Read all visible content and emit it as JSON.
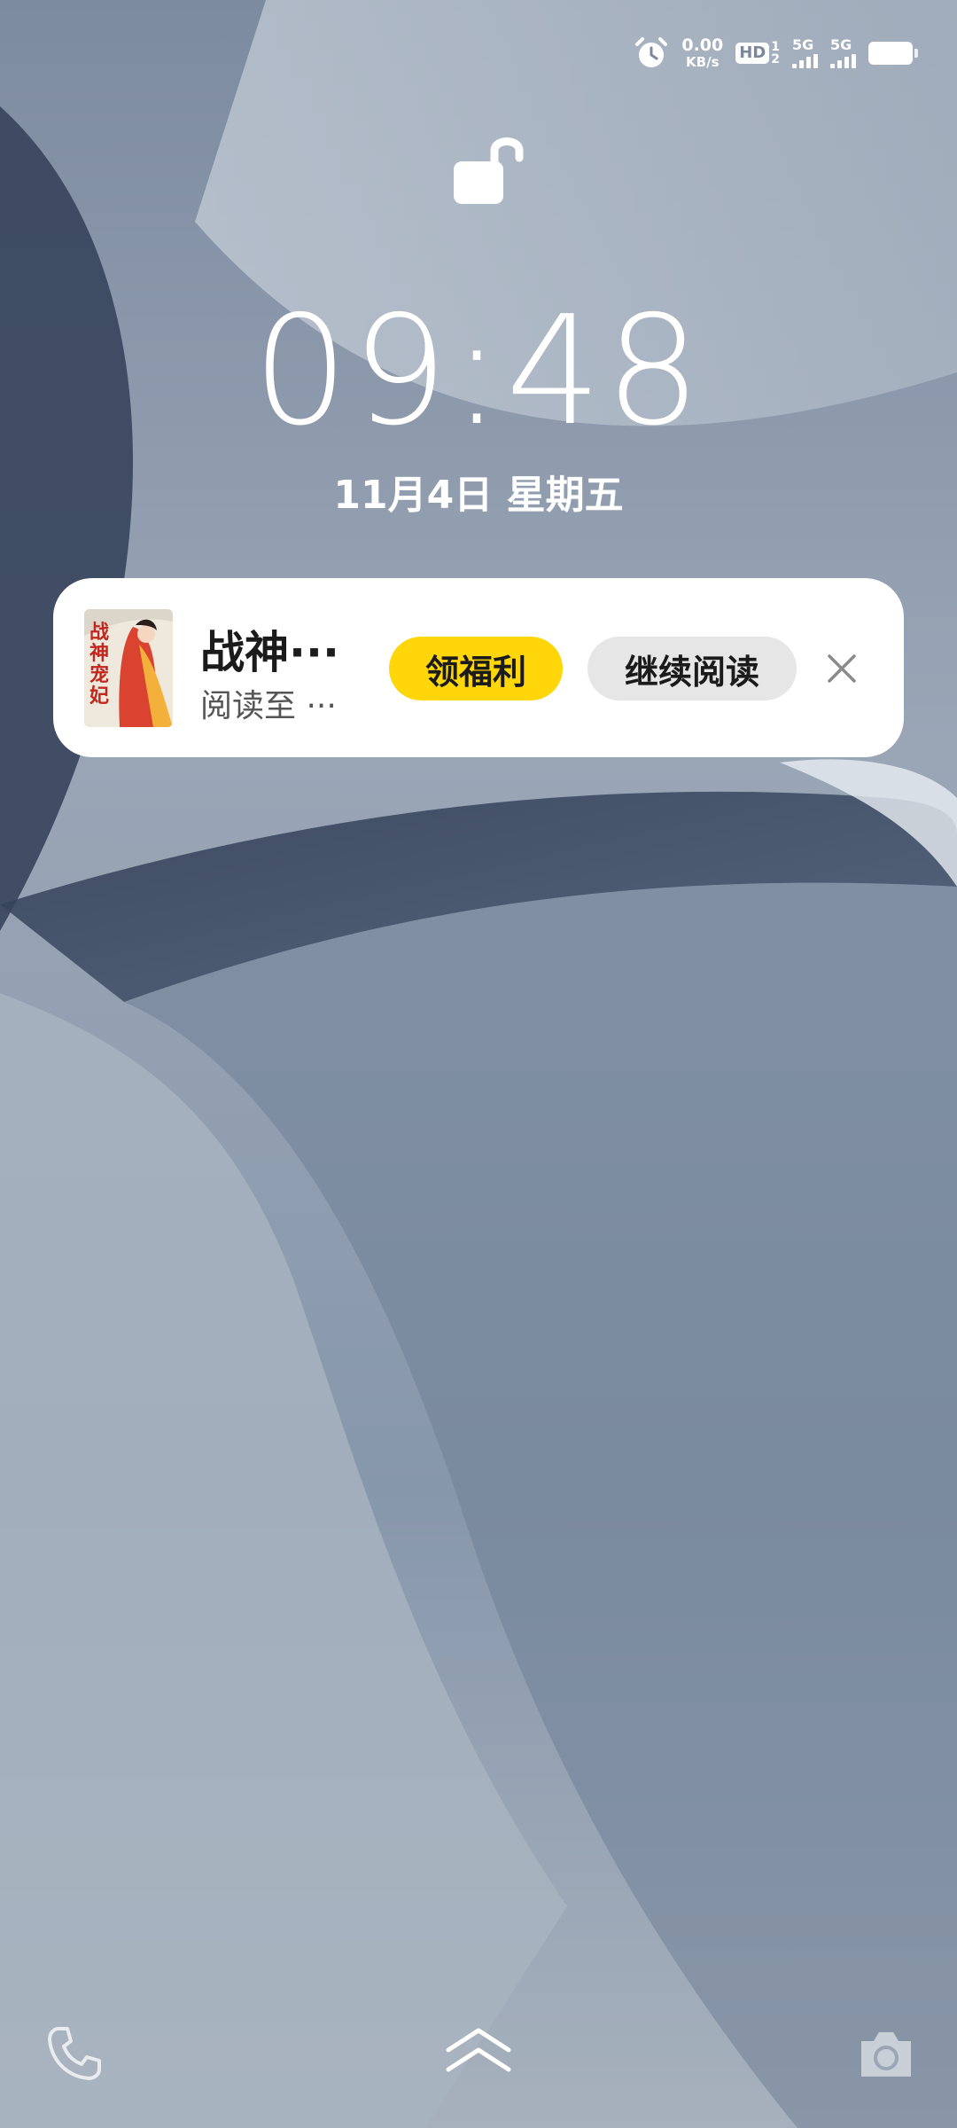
{
  "status_bar": {
    "alarm_icon": "alarm-clock-icon",
    "net_speed_value": "0.00",
    "net_speed_unit": "KB/s",
    "hd_label": "HD",
    "hd_sim_top": "1",
    "hd_sim_bottom": "2",
    "sim1_label": "5G",
    "sim2_label": "5G",
    "battery_icon": "battery-icon"
  },
  "lock_icon": "unlocked-padlock-icon",
  "clock": {
    "time": "09:48",
    "date": "11月4日  星期五"
  },
  "notification": {
    "title": "战神···",
    "subtitle": "阅读至 ···",
    "cover_text": "战神宠妃",
    "welfare_button": "领福利",
    "continue_button": "继续阅读",
    "welfare_color": "#ffd60a",
    "close_icon": "close-icon"
  },
  "bottom": {
    "phone_icon": "phone-icon",
    "swipe_icon": "double-chevron-up-icon",
    "camera_icon": "camera-icon"
  }
}
